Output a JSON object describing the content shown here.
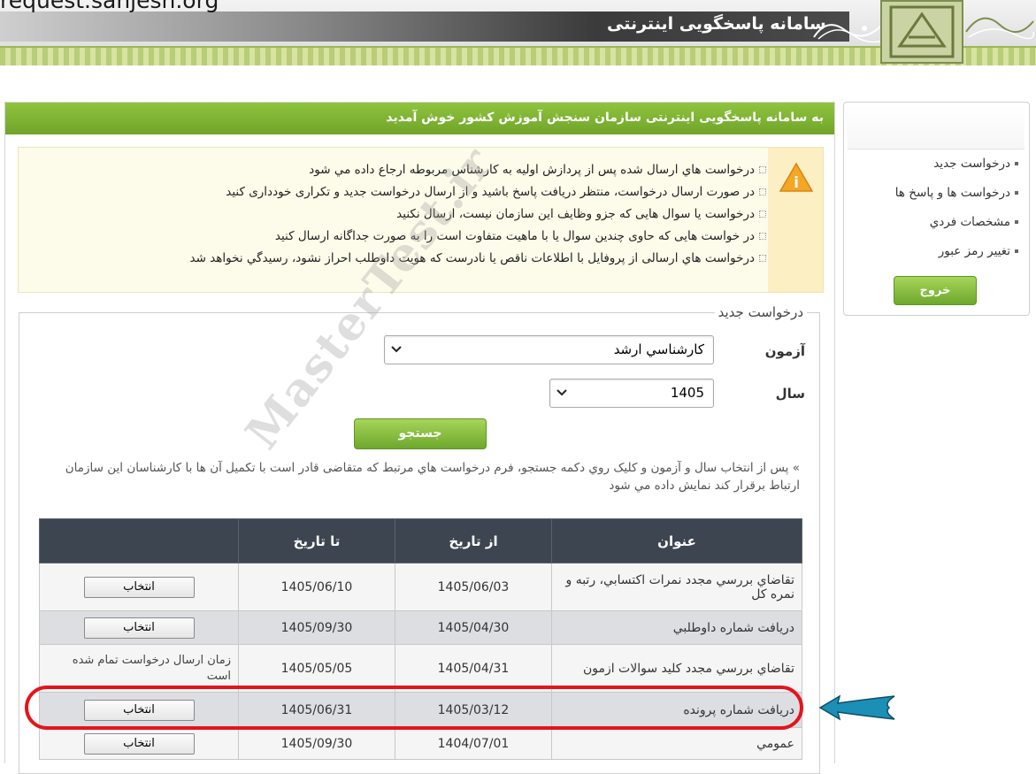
{
  "header": {
    "url_text": "request.sanjesh.org",
    "system_title": "سامانه پاسخگويی اینترنتی"
  },
  "welcome": "به سامانه پاسخگويی اينترنتی سازمان سنجش آموزش کشور خوش آمديد",
  "notice": {
    "items": [
      "درخواست هاي ارسال شده پس از پردازش اوليه به کارشناس مربوطه ارجاع داده مي شود",
      "در صورت ارسال درخواست، منتظر دريافت پاسخ باشيد و از ارسال درخواست جديد و تکراری خودداری کنيد",
      "درخواست يا سوال هايی که جزو وظايف اين سازمان نيست، ارسال نکنيد",
      "در خواست هايی که حاوی چندين سوال يا با ماهيت متفاوت است را به صورت جداگانه ارسال کنيد",
      "درخواست هاي ارسالی از پروفايل با اطلاعات ناقص يا نادرست که هويت داوطلب احراز نشود، رسيدگي نخواهد شد"
    ]
  },
  "form": {
    "legend": "درخواست جديد",
    "exam_label": "آزمون",
    "exam_value": "کارشناسي ارشد",
    "year_label": "سال",
    "year_value": "1405",
    "search_label": "جستجو",
    "hint": "» پس از انتخاب سال و آزمون و کليک روي دکمه جستجو، فرم درخواست هاي مرتبط که متقاضی قادر است با تکميل آن ها با کارشناسان اين سازمان ارتباط برقرار کند نمايش داده مي شود"
  },
  "table": {
    "headers": [
      "عنوان",
      "از تاريخ",
      "تا تاريخ",
      ""
    ],
    "rows": [
      {
        "title": "تقاضاي بررسي مجدد نمرات اکتسابي، رتبه و نمره کل",
        "from": "1405/06/03",
        "to": "1405/06/10",
        "action": "انتخاب"
      },
      {
        "title": "دريافت شماره داوطلبي",
        "from": "1405/04/30",
        "to": "1405/09/30",
        "action": "انتخاب"
      },
      {
        "title": "تقاضاي بررسي مجدد کليد سوالات ازمون",
        "from": "1405/04/31",
        "to": "1405/05/05",
        "action": "زمان ارسال درخواست تمام شده است"
      },
      {
        "title": "دريافت شماره پرونده",
        "from": "1405/03/12",
        "to": "1405/06/31",
        "action": "انتخاب"
      },
      {
        "title": "عمومي",
        "from": "1404/07/01",
        "to": "1405/09/30",
        "action": "انتخاب"
      }
    ]
  },
  "sidebar": {
    "items": [
      {
        "label": "درخواست جديد"
      },
      {
        "label": "درخواست ها و پاسخ ها"
      },
      {
        "label": "مشخصات فردي"
      },
      {
        "label": "تغيير رمز عبور"
      }
    ],
    "exit_label": "خروج"
  },
  "watermark": "MasterTest.ir",
  "colors": {
    "accent_green": "#7fb534",
    "table_header": "#3d4650",
    "highlight_red": "#e4141b",
    "arrow_blue": "#1b8fb5"
  }
}
